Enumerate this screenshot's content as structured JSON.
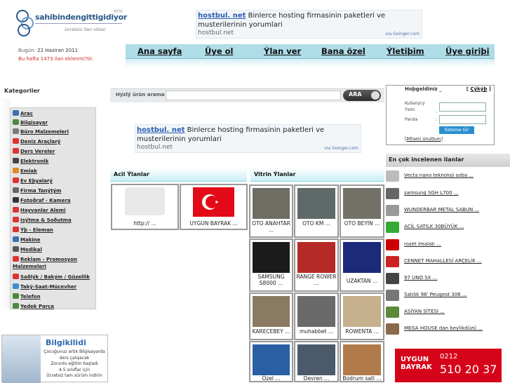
{
  "logo": {
    "name": "sahibindengittigidiyor",
    "tag": "ücretsiz ilan sitesi",
    "beta": "BETA"
  },
  "ad": {
    "title": "hostbul. net",
    "text": "Binlerce hosting firmasinin paketleri ve musterilerinin yorumlari",
    "url": "hostbul.net",
    "via": "via Goinger.com"
  },
  "nav": [
    {
      "label": "Ana sayfa"
    },
    {
      "label": "Üye ol"
    },
    {
      "label": "Ýlan ver"
    },
    {
      "label": "Bana özel"
    },
    {
      "label": "Ýletiþim"
    },
    {
      "label": "Üye giriþi"
    }
  ],
  "left": {
    "date_prefix": "Bugün:",
    "date": "22 Haziran 2011",
    "online": "Bu hafta 1473 ilan eklenmi?tir.",
    "categories_title": "Kategoriler"
  },
  "categories": [
    {
      "label": "Araç",
      "color": "#3b6fb6"
    },
    {
      "label": "Bilgisayar",
      "color": "#4a8a3a"
    },
    {
      "label": "Büro Malzemeleri",
      "color": "#7a7a7a"
    },
    {
      "label": "Deniz Araçlarý",
      "color": "#d33"
    },
    {
      "label": "Ders Vereler",
      "color": "#d33"
    },
    {
      "label": "Elektronik",
      "color": "#444"
    },
    {
      "label": "Emlak",
      "color": "#e08a1e"
    },
    {
      "label": "Ev Eþyalarý",
      "color": "#d33"
    },
    {
      "label": "Firma Tanýtým",
      "color": "#666"
    },
    {
      "label": "Fotoðraf - Kamera",
      "color": "#333"
    },
    {
      "label": "Hayvanlar Alemi",
      "color": "#d33"
    },
    {
      "label": "Isýtma & Soðutma",
      "color": "#d33"
    },
    {
      "label": "Ýþ - Eleman",
      "color": "#d33"
    },
    {
      "label": "Makine",
      "color": "#3b6fb6"
    },
    {
      "label": "Medikal",
      "color": "#555"
    },
    {
      "label": "Reklam - Promosyon Malzemeleri",
      "color": "#d33"
    },
    {
      "label": "Saðlýk / Bakým / Güzellik",
      "color": "#d33"
    },
    {
      "label": "Taký-Saat-Mücevher",
      "color": "#3b8fd0"
    },
    {
      "label": "Telefon",
      "color": "#4a8a3a"
    },
    {
      "label": "Yedek Parça",
      "color": "#4a8a3a"
    }
  ],
  "search": {
    "label": "Hýzlý ürün arama",
    "button": "ARA",
    "placeholder": ""
  },
  "sections": {
    "urgent": "Acil Ýlanlar",
    "showcase": "Vitrin Ýlanlar"
  },
  "urgent_items": [
    {
      "label": "http:// ...",
      "color": "#e6e6e6"
    },
    {
      "label": "UYGUN BAYRAK ...",
      "color": "#e30a17"
    }
  ],
  "showcase_items": [
    {
      "label": "OTO ANAHTAR ...",
      "color": "#6d6d64"
    },
    {
      "label": "OTO KM ...",
      "color": "#5f6968"
    },
    {
      "label": "OTO BEYİN ...",
      "color": "#747168"
    },
    {
      "label": "SAMSUNG S8000 ...",
      "color": "#1b1b1b"
    },
    {
      "label": "RANGE ROWER ...",
      "color": "#b52a26"
    },
    {
      "label": "UZAKTAN ...",
      "color": "#1c2a7a"
    },
    {
      "label": "KARECEBEY ...",
      "color": "#8a7a62"
    },
    {
      "label": "muhabbet ...",
      "color": "#6a6a6a"
    },
    {
      "label": "ROWENTA ...",
      "color": "#c7b08d"
    },
    {
      "label": "Özel ...",
      "color": "#2a5fa5"
    },
    {
      "label": "Devren ...",
      "color": "#4a5a6a"
    },
    {
      "label": "Bodrum satl ...",
      "color": "#b07a4a"
    }
  ],
  "login": {
    "greeting": "Hoþgeldiniz",
    "logout": "Çýkýþ",
    "user_label": "Kullanýcý Ýsmi",
    "pass_label": "Parola",
    "button": "Sisteme Gir",
    "forgot": "Þifremi Unuttum"
  },
  "most_viewed_title": "En çok incelenen ilanlar",
  "most_viewed": [
    {
      "label": "Vecta nano teknoloji soba ...",
      "color": "#bbb"
    },
    {
      "label": "samsung SGH L700 ...",
      "color": "#666"
    },
    {
      "label": "WUNDERBAR METAL SABUN ...",
      "color": "#999"
    },
    {
      "label": "ACİL SATILK 30BÜYÜK ...",
      "color": "#3a3"
    },
    {
      "label": "rozet imalatı ...",
      "color": "#c00"
    },
    {
      "label": "CENNET MAHALLESİ ARÇELİK ...",
      "color": "#c22"
    },
    {
      "label": "97 UNO SX ...",
      "color": "#444"
    },
    {
      "label": "Satılık 98' Peugeot 306 ...",
      "color": "#777"
    },
    {
      "label": "ASİYAN SİTESİ ...",
      "color": "#5a8a3a"
    },
    {
      "label": "MEGA HOUSE dan beylikdüzü ...",
      "color": "#8a6a4a"
    }
  ],
  "bottom_ads": {
    "bilgi_title": "Bilgikilidi",
    "bilgi_lines": [
      "Çocuğunuz artık Bilgisayarda",
      "ders çalışacak",
      "Zorunlu eğitim başladı",
      "4-5 sınıflar için",
      "Ücretsiz tam sürüm indirin"
    ],
    "uygun_brand": "UYGUN BAYRAK",
    "uygun_phone_prefix": "0212",
    "uygun_phone": "510 20 37"
  }
}
